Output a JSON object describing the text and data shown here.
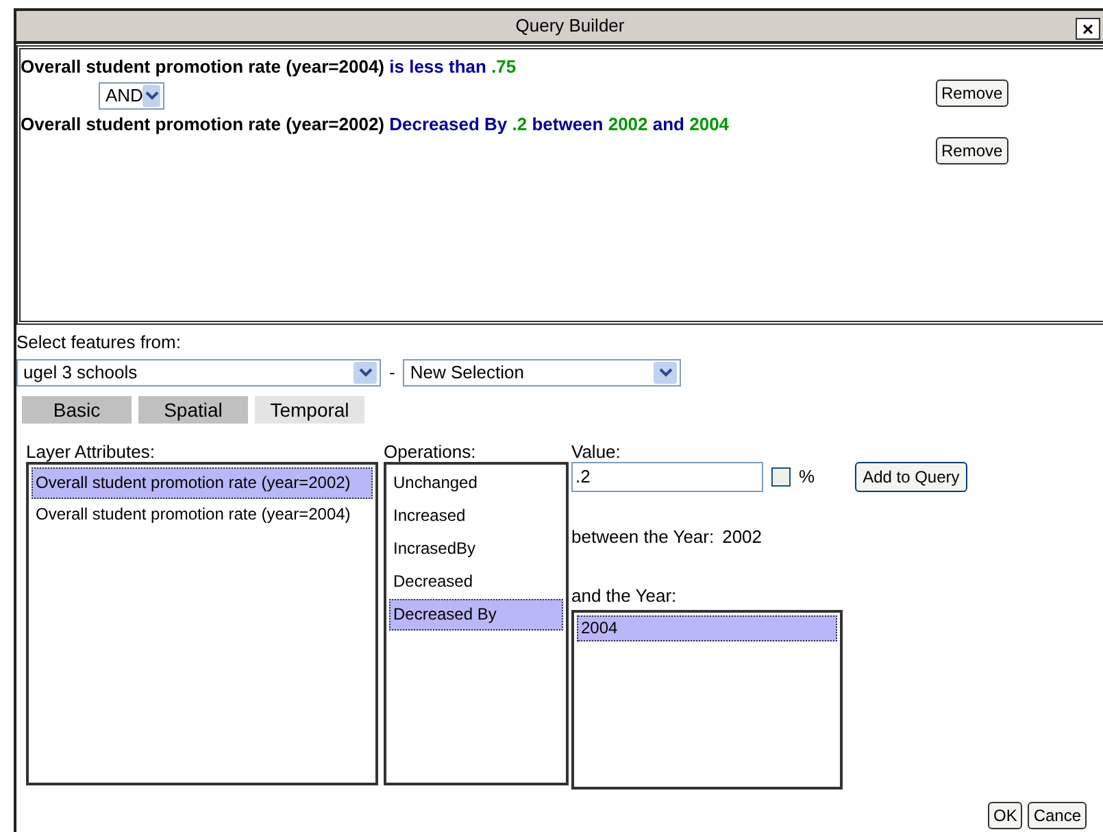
{
  "window": {
    "title": "Query Builder",
    "close_glyph": "×"
  },
  "query": {
    "conditions": [
      {
        "parts": [
          {
            "kind": "field",
            "text": "Overall student promotion rate (year=2004)"
          },
          {
            "kind": "op",
            "text": " is less than "
          },
          {
            "kind": "value",
            "text": ".75"
          }
        ],
        "remove_label": "Remove"
      },
      {
        "parts": [
          {
            "kind": "field",
            "text": "Overall student promotion rate (year=2002)"
          },
          {
            "kind": "op",
            "text": " Decreased By "
          },
          {
            "kind": "value",
            "text": ".2"
          },
          {
            "kind": "op",
            "text": " between "
          },
          {
            "kind": "value",
            "text": "2002"
          },
          {
            "kind": "op",
            "text": " and "
          },
          {
            "kind": "value",
            "text": "2004"
          }
        ],
        "remove_label": "Remove"
      }
    ],
    "connector": "AND"
  },
  "select_features": {
    "label": "Select features from:",
    "layer": "ugel 3 schools",
    "separator": "-",
    "mode": "New Selection"
  },
  "tabs": [
    {
      "label": "Basic",
      "selected": false
    },
    {
      "label": "Spatial",
      "selected": false
    },
    {
      "label": "Temporal",
      "selected": true
    }
  ],
  "layer_attributes": {
    "label": "Layer Attributes:",
    "items": [
      {
        "text": "Overall student promotion rate (year=2002)",
        "selected": true
      },
      {
        "text": "Overall student promotion rate (year=2004)",
        "selected": false
      }
    ]
  },
  "operations": {
    "label": "Operations:",
    "items": [
      {
        "text": "Unchanged",
        "selected": false
      },
      {
        "text": "Increased",
        "selected": false
      },
      {
        "text": "IncrasedBy",
        "selected": false
      },
      {
        "text": "Decreased",
        "selected": false
      },
      {
        "text": "Decreased By",
        "selected": true
      }
    ]
  },
  "value": {
    "label": "Value:",
    "value": ".2",
    "percent_checked": false,
    "percent_label": "%",
    "add_button": "Add to Query"
  },
  "between": {
    "label": "between the Year:",
    "year": "2002"
  },
  "and_year": {
    "label": "and the Year:",
    "items": [
      {
        "text": "2004",
        "selected": true
      }
    ]
  },
  "buttons": [
    "OK",
    "Cance"
  ]
}
